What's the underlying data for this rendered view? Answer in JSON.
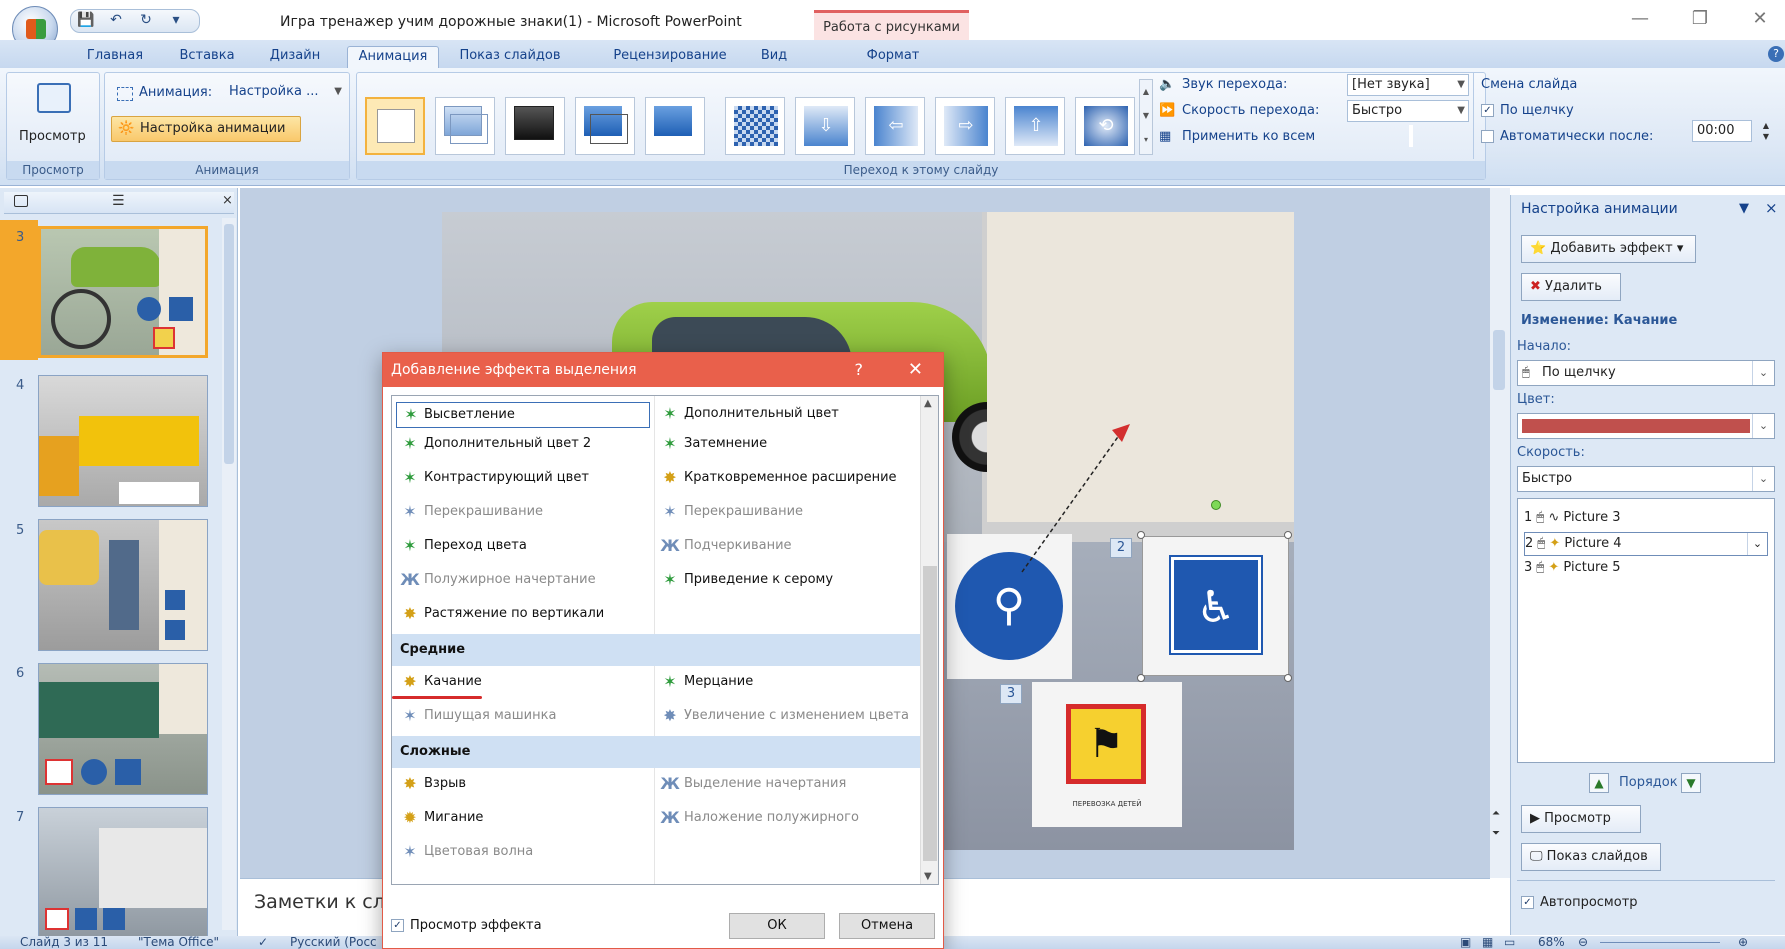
{
  "window": {
    "title": "Игра тренажер учим дорожные знаки(1) - Microsoft PowerPoint",
    "context_tab": "Работа с рисунками"
  },
  "tabs": [
    "Главная",
    "Вставка",
    "Дизайн",
    "Анимация",
    "Показ слайдов",
    "Рецензирование",
    "Вид",
    "Формат"
  ],
  "ribbon": {
    "preview_button": "Просмотр",
    "preview_group": "Просмотр",
    "animation_label": "Анимация:",
    "animation_value": "Настройка ...",
    "custom_animation_button": "Настройка анимации",
    "animation_group": "Анимация",
    "transition_sound_label": "Звук перехода:",
    "transition_sound_value": "[Нет звука]",
    "transition_speed_label": "Скорость перехода:",
    "transition_speed_value": "Быстро",
    "apply_all": "Применить ко всем",
    "transition_group": "Переход к этому слайду",
    "advance_title": "Смена слайда",
    "on_click": "По щелчку",
    "auto_after": "Автоматически после:",
    "auto_time": "00:00"
  },
  "slides": {
    "numbers": [
      "3",
      "4",
      "5",
      "6",
      "7"
    ],
    "selected": "3"
  },
  "slide_badges": [
    "2",
    "3"
  ],
  "sign_caption": "ПЕРЕВОЗКА ДЕТЕЙ",
  "notes": "Заметки к сл",
  "pane": {
    "title": "Настройка анимации",
    "add_effect": "Добавить эффект",
    "remove": "Удалить",
    "change_heading": "Изменение: Качание",
    "start_label": "Начало:",
    "start_value": "По щелчку",
    "color_label": "Цвет:",
    "color_value": "#c0504d",
    "speed_label": "Скорость:",
    "speed_value": "Быстро",
    "items": [
      {
        "num": "1",
        "name": "Picture 3"
      },
      {
        "num": "2",
        "name": "Picture 4"
      },
      {
        "num": "3",
        "name": "Picture 5"
      }
    ],
    "order": "Порядок",
    "play": "Просмотр",
    "slideshow": "Показ слайдов",
    "autopreview": "Автопросмотр"
  },
  "dialog": {
    "title": "Добавление эффекта выделения",
    "help": "?",
    "col1_basic": [
      "Высветление",
      "Дополнительный цвет 2",
      "Контрастирующий цвет",
      "Перекрашивание",
      "Переход цвета",
      "Полужирное начертание",
      "Растяжение по вертикали"
    ],
    "col2_basic": [
      "Дополнительный цвет",
      "Затемнение",
      "Кратковременное расширение",
      "Перекрашивание",
      "Подчеркивание",
      "Приведение к серому"
    ],
    "cat_medium": "Средние",
    "col1_medium": [
      "Качание",
      "Пишущая машинка"
    ],
    "col2_medium": [
      "Мерцание",
      "Увеличение с изменением цвета"
    ],
    "cat_complex": "Сложные",
    "col1_complex": [
      "Взрыв",
      "Мигание",
      "Цветовая волна"
    ],
    "col2_complex": [
      "Выделение начертания",
      "Наложение полужирного"
    ],
    "preview_effect": "Просмотр эффекта",
    "ok": "ОК",
    "cancel": "Отмена"
  },
  "status": {
    "slide_info": "Слайд 3 из 11",
    "theme": "\"Тема Office\"",
    "language": "Русский (Росс",
    "zoom": "68%"
  },
  "colors": {
    "dialog_title_bg": "#e9604b",
    "accent_selected": "#f3a72b",
    "category_bg": "#cfe0f3"
  }
}
